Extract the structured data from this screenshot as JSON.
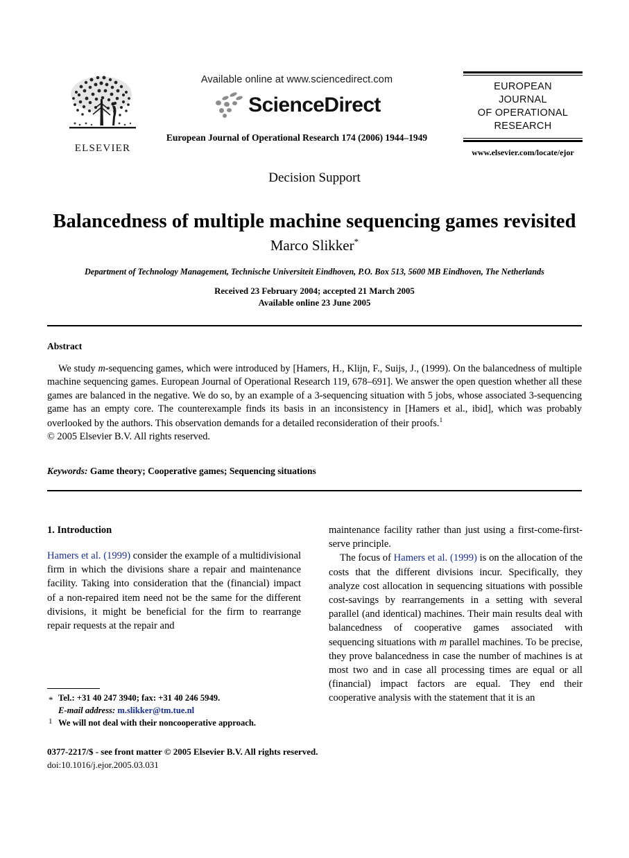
{
  "masthead": {
    "elsevier_wordmark": "ELSEVIER",
    "sciencedirect": {
      "available_line": "Available online at www.sciencedirect.com",
      "brand": "ScienceDirect"
    },
    "citation": "European Journal of Operational Research 174 (2006) 1944–1949",
    "journal_box": {
      "line1": "EUROPEAN",
      "line2": "JOURNAL",
      "line3": "OF OPERATIONAL",
      "line4": "RESEARCH",
      "url": "www.elsevier.com/locate/ejor"
    }
  },
  "article": {
    "section_kind": "Decision Support",
    "title": "Balancedness of multiple machine sequencing games revisited",
    "author": "Marco Slikker",
    "author_footnote_mark": "*",
    "affiliation": "Department of Technology Management, Technische Universiteit Eindhoven, P.O. Box 513, 5600 MB Eindhoven, The Netherlands",
    "received_line": "Received 23 February 2004; accepted 21 March 2005",
    "available_line": "Available online 23 June 2005"
  },
  "abstract": {
    "heading": "Abstract",
    "text_part1": "We study ",
    "text_italic_m": "m",
    "text_part2": "-sequencing games, which were introduced by [Hamers, H., Klijn, F., Suijs, J., (1999). On the balancedness of multiple machine sequencing games. European Journal of Operational Research 119, 678–691]. We answer the open question whether all these games are balanced in the negative. We do so, by an example of a 3-sequencing situation with 5 jobs, whose associated 3-sequencing game has an empty core. The counterexample finds its basis in an inconsistency in [Hamers et al., ibid], which was probably overlooked by the authors. This observation demands for a detailed reconsideration of their proofs.",
    "footnote_mark": "1",
    "copyright": "© 2005 Elsevier B.V. All rights reserved."
  },
  "keywords": {
    "label": "Keywords:",
    "value": "Game theory; Cooperative games; Sequencing situations"
  },
  "body": {
    "section_number_title": "1. Introduction",
    "left_column": {
      "para1_link": "Hamers et al. (1999)",
      "para1_rest": " consider the example of a multidivisional firm in which the divisions share a repair and maintenance facility. Taking into consideration that the (financial) impact of a non-repaired item need not be the same for the different divisions, it might be beneficial for the firm to rearrange repair requests at the repair and"
    },
    "right_column": {
      "para_cont": "maintenance facility rather than just using a first-come-first-serve principle.",
      "para2_pre": "The focus of ",
      "para2_link": "Hamers et al. (1999)",
      "para2_post_a": " is on the allocation of the costs that the different divisions incur. Specifically, they analyze cost allocation in sequencing situations with possible cost-savings by rearrangements in a setting with several parallel (and identical) machines. Their main results deal with balancedness of cooperative games associated with sequencing situations with ",
      "para2_italic_m": "m",
      "para2_post_b": " parallel machines. To be precise, they prove balancedness in case the number of machines is at most two and in case all processing times are equal or all (financial) impact factors are equal. They end their cooperative analysis with the statement that it is an"
    }
  },
  "footnotes": [
    {
      "mark": "*",
      "text": "Tel.: +31 40 247 3940; fax: +31 40 246 5949.",
      "email_label": "E-mail address:",
      "email": "m.slikker@tm.tue.nl"
    },
    {
      "mark": "1",
      "text": "We will not deal with their noncooperative approach."
    }
  ],
  "footer": {
    "issn_line": "0377-2217/$ - see front matter © 2005 Elsevier B.V. All rights reserved.",
    "doi_line": "doi:10.1016/j.ejor.2005.03.031"
  },
  "colors": {
    "link": "#1a2f8c",
    "text": "#000000",
    "paper": "#ffffff"
  }
}
